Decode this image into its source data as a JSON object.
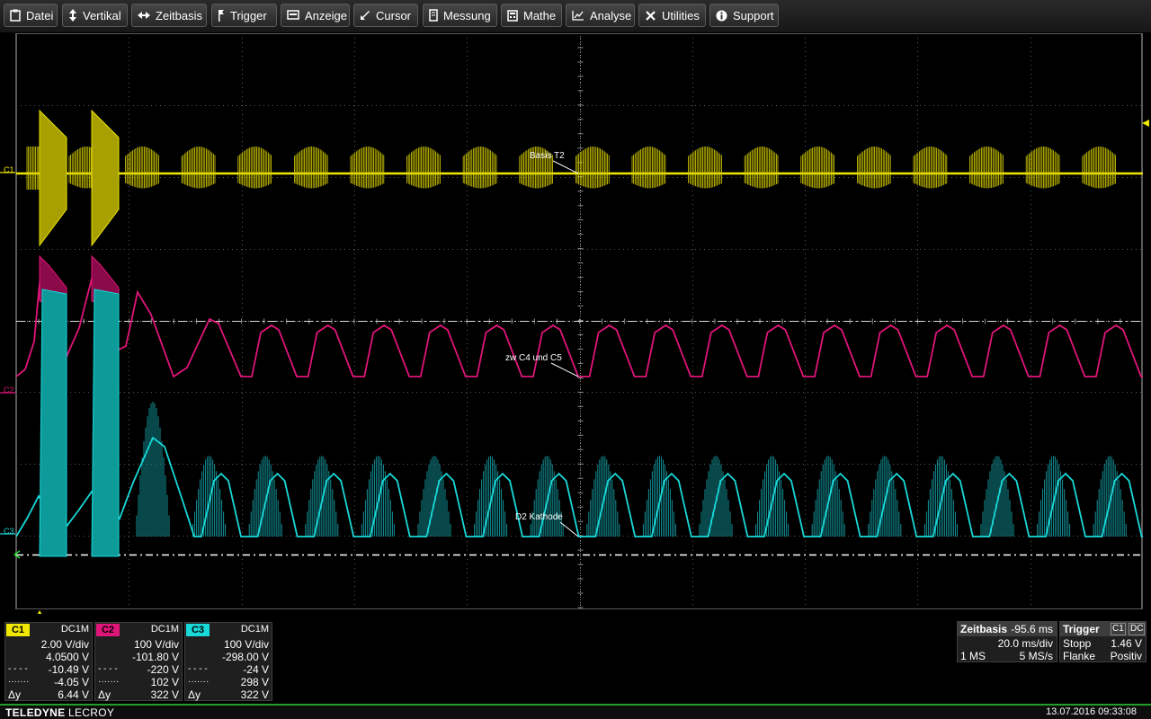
{
  "menu": {
    "items": [
      {
        "label": "Datei",
        "icon": "clipboard-icon"
      },
      {
        "label": "Vertikal",
        "icon": "vertical-arrows-icon"
      },
      {
        "label": "Zeitbasis",
        "icon": "horizontal-arrows-icon"
      },
      {
        "label": "Trigger",
        "icon": "trigger-flag-icon"
      },
      {
        "label": "Anzeige",
        "icon": "display-icon"
      },
      {
        "label": "Cursor",
        "icon": "cursor-arrow-icon"
      },
      {
        "label": "Messung",
        "icon": "meter-icon"
      },
      {
        "label": "Mathe",
        "icon": "calculator-icon"
      },
      {
        "label": "Analyse",
        "icon": "chart-icon"
      },
      {
        "label": "Utilities",
        "icon": "tools-icon"
      },
      {
        "label": "Support",
        "icon": "info-icon"
      }
    ]
  },
  "screen": {
    "trace_labels": {
      "c1": "Basis T2",
      "c2": "zw C4 und C5",
      "c3": "D2 Kathode"
    },
    "markers": {
      "c1": "C1",
      "c2": "C2",
      "c3": "C3"
    }
  },
  "channels": [
    {
      "tag": "C1",
      "color": "#f0e800",
      "coupling": "DC1M",
      "vdiv": "2.00 V/div",
      "offset": "4.0500 V",
      "cursor1_value": "-10.49 V",
      "cursor2_value": "-4.05 V",
      "dy_label": "Δy",
      "dy_value": "6.44 V"
    },
    {
      "tag": "C2",
      "color": "#e0157a",
      "coupling": "DC1M",
      "vdiv": "100 V/div",
      "offset": "-101.80 V",
      "cursor1_value": "-220 V",
      "cursor2_value": "102 V",
      "dy_label": "Δy",
      "dy_value": "322 V"
    },
    {
      "tag": "C3",
      "color": "#18d8d8",
      "coupling": "DC1M",
      "vdiv": "100 V/div",
      "offset": "-298.00 V",
      "cursor1_value": "-24 V",
      "cursor2_value": "298 V",
      "dy_label": "Δy",
      "dy_value": "322 V"
    }
  ],
  "timebase": {
    "title": "Zeitbasis",
    "delay": "-95.6 ms",
    "tdiv": "20.0 ms/div",
    "samples": "1 MS",
    "rate": "5 MS/s"
  },
  "trigger": {
    "title": "Trigger",
    "source": "C1",
    "coupling": "DC",
    "mode": "Stopp",
    "level": "1.46 V",
    "type": "Flanke",
    "slope": "Positiv"
  },
  "footer": {
    "brand_bold": "TELEDYNE",
    "brand_light": "LECROY",
    "datetime": "13.07.2016 09:33:08"
  }
}
